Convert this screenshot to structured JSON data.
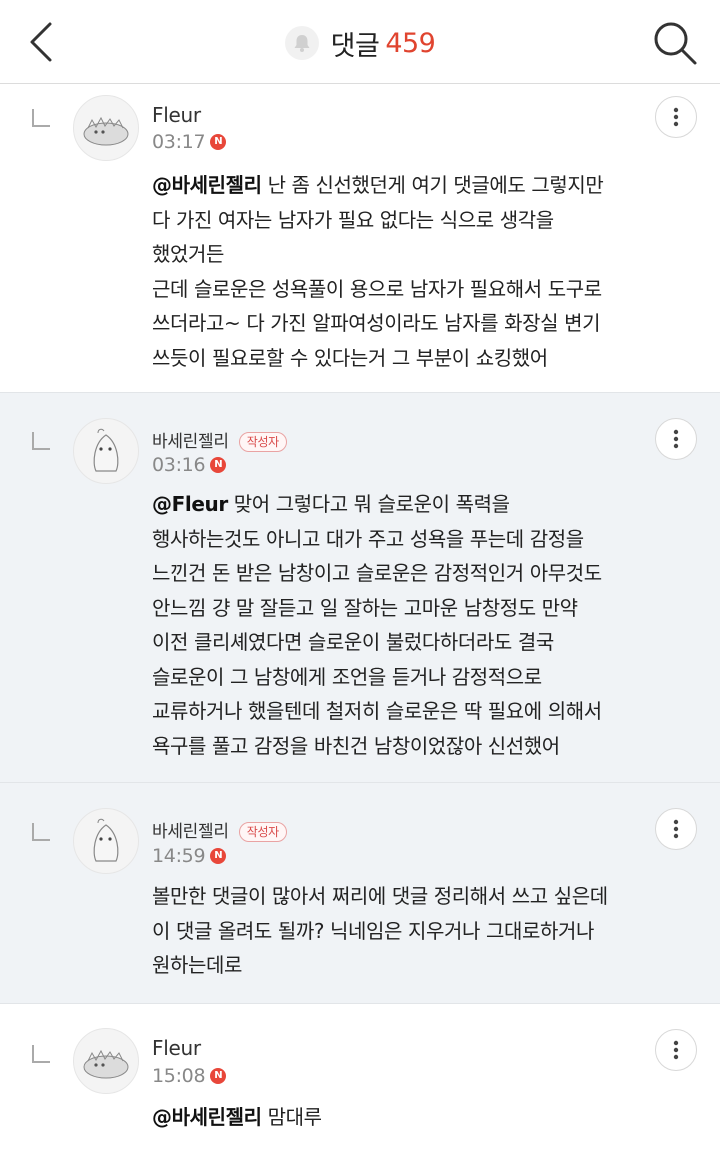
{
  "header": {
    "title": "댓글",
    "count": "459"
  },
  "comments": [
    {
      "author": "Fleur",
      "badge": "",
      "time": "03:17",
      "new_mark": "N",
      "mention": "@바세린젤리",
      "lines": [
        " 난 좀 신선했던게 여기 댓글에도 그렇지만",
        "다 가진 여자는 남자가 필요 없다는 식으로 생각을",
        "했었거든",
        "근데 슬로운은 성욕풀이 용으로 남자가 필요해서 도구로",
        "쓰더라고~ 다 가진 알파여성이라도 남자를 화장실 변기",
        "쓰듯이 필요로할 수 있다는거 그 부분이 쇼킹했어"
      ]
    },
    {
      "author": "바세린젤리",
      "badge": "작성자",
      "time": "03:16",
      "new_mark": "N",
      "mention": "@Fleur",
      "lines": [
        " 맞어 그렇다고 뭐 슬로운이 폭력을",
        "행사하는것도 아니고 대가 주고 성욕을 푸는데 감정을",
        "느낀건 돈 받은 남창이고 슬로운은 감정적인거 아무것도",
        "안느낌 걍 말 잘듣고 일 잘하는 고마운 남창정도 만약",
        "이전 클리셰였다면 슬로운이 불렀다하더라도 결국",
        "슬로운이 그 남창에게 조언을 듣거나 감정적으로",
        "교류하거나 했을텐데 철저히 슬로운은 딱 필요에 의해서",
        "욕구를 풀고 감정을 바친건 남창이었잖아 신선했어"
      ]
    },
    {
      "author": "바세린젤리",
      "badge": "작성자",
      "time": "14:59",
      "new_mark": "N",
      "mention": "",
      "lines": [
        "볼만한 댓글이 많아서 쩌리에 댓글 정리해서 쓰고 싶은데",
        "이 댓글 올려도 될까? 닉네임은 지우거나 그대로하거나",
        "원하는데로"
      ]
    },
    {
      "author": "Fleur",
      "badge": "",
      "time": "15:08",
      "new_mark": "N",
      "mention": "@바세린젤리",
      "lines": [
        " 맘대루"
      ]
    }
  ],
  "icons": {
    "back": "chevron-left-icon",
    "search": "search-icon",
    "bell": "bell-icon",
    "more": "more-vertical-icon",
    "reply": "reply-arrow-icon"
  },
  "colors": {
    "accent": "#e0442f",
    "new_dot": "#e8473a",
    "reply_bg": "#f0f3f6"
  }
}
